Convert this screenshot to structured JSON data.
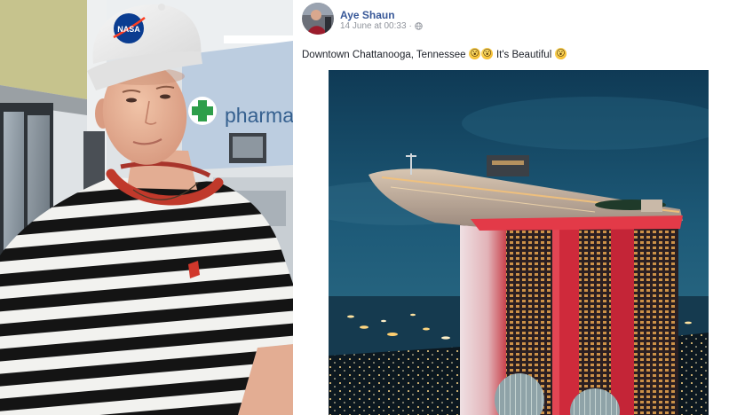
{
  "left_photo": {
    "sign_text": "pharma",
    "cap_logo_text": "NASA"
  },
  "post": {
    "author": "Aye Shaun",
    "timestamp": "14 June at 00:33",
    "separator": "·",
    "privacy_icon": "globe-icon",
    "text_segments": [
      {
        "text": "Downtown Chattanooga, Tennessee "
      },
      {
        "emoji": "😮"
      },
      {
        "emoji": "😮"
      },
      {
        "text": " It's Beautiful "
      },
      {
        "emoji": "😮"
      }
    ]
  },
  "colors": {
    "author_link": "#385898",
    "meta_text": "#90949c",
    "post_text": "#1d2129",
    "background": "#ffffff"
  }
}
